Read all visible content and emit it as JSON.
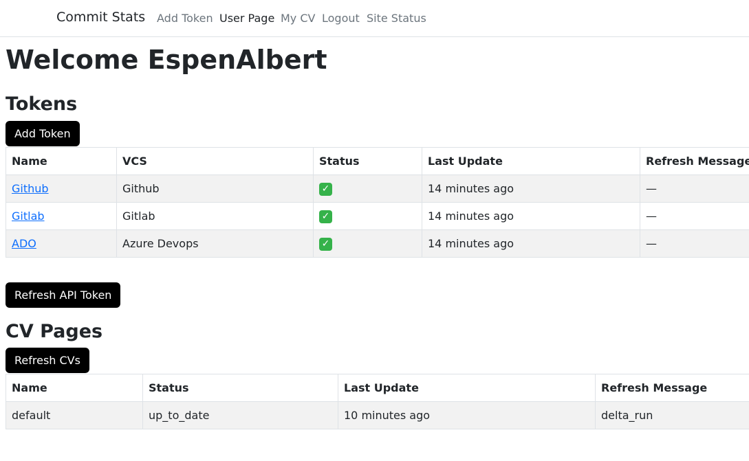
{
  "nav": {
    "brand": "Commit Stats",
    "links": [
      "Add Token",
      "User Page",
      "My CV",
      "Logout",
      "Site Status"
    ]
  },
  "welcome": "Welcome EspenAlbert",
  "tokens": {
    "heading": "Tokens",
    "add_button": "Add Token",
    "columns": [
      "Name",
      "VCS",
      "Status",
      "Last Update",
      "Refresh Message"
    ],
    "rows": [
      {
        "name": "Github",
        "vcs": "Github",
        "status": "ok",
        "last_update": "14 minutes ago",
        "message": "—"
      },
      {
        "name": "Gitlab",
        "vcs": "Gitlab",
        "status": "ok",
        "last_update": "14 minutes ago",
        "message": "—"
      },
      {
        "name": "ADO",
        "vcs": "Azure Devops",
        "status": "ok",
        "last_update": "14 minutes ago",
        "message": "—"
      }
    ]
  },
  "refresh_api_button": "Refresh API Token",
  "cv": {
    "heading": "CV Pages",
    "refresh_button": "Refresh CVs",
    "columns": [
      "Name",
      "Status",
      "Last Update",
      "Refresh Message"
    ],
    "rows": [
      {
        "name": "default",
        "status": "up_to_date",
        "last_update": "10 minutes ago",
        "message": "delta_run"
      }
    ]
  }
}
